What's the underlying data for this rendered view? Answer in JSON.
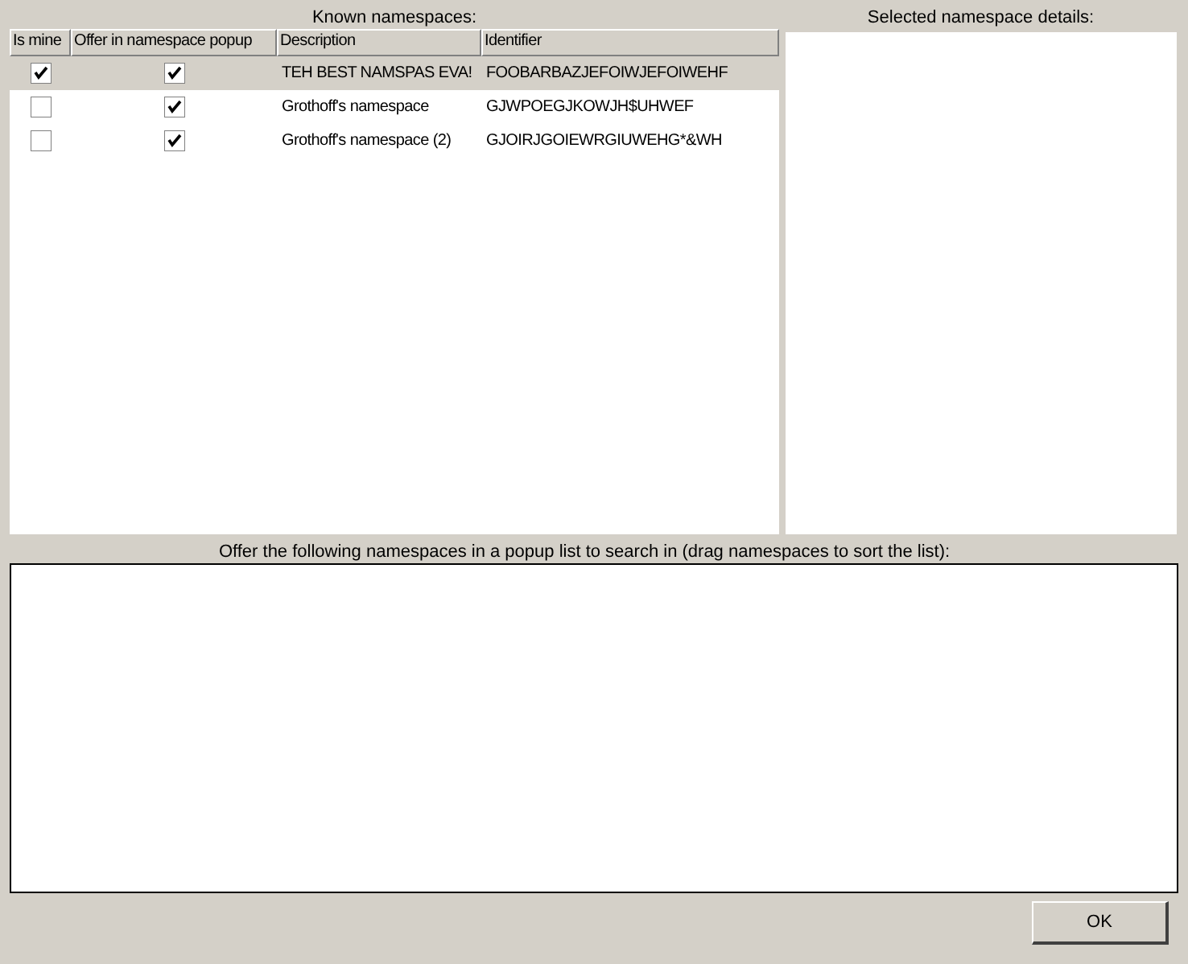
{
  "known_namespaces": {
    "label": "Known namespaces:",
    "columns": [
      "Is mine",
      "Offer in namespace popup",
      "Description",
      "Identifier"
    ],
    "rows": [
      {
        "is_mine": true,
        "offer_in_popup": true,
        "description": "TEH BEST NAMSPAS EVA!",
        "identifier": "FOOBARBAZJEFOIWJEFOIWEHF",
        "selected": true
      },
      {
        "is_mine": false,
        "offer_in_popup": true,
        "description": "Grothoff's namespace",
        "identifier": "GJWPOEGJKOWJH$UHWEF",
        "selected": false
      },
      {
        "is_mine": false,
        "offer_in_popup": true,
        "description": "Grothoff's namespace (2)",
        "identifier": "GJOIRJGOIEWRGIUWEHG*&WH",
        "selected": false
      }
    ]
  },
  "details": {
    "label": "Selected namespace details:"
  },
  "popup_list": {
    "label": "Offer the following namespaces in a popup list to search in (drag namespaces to sort the list):"
  },
  "buttons": [
    "OK"
  ]
}
